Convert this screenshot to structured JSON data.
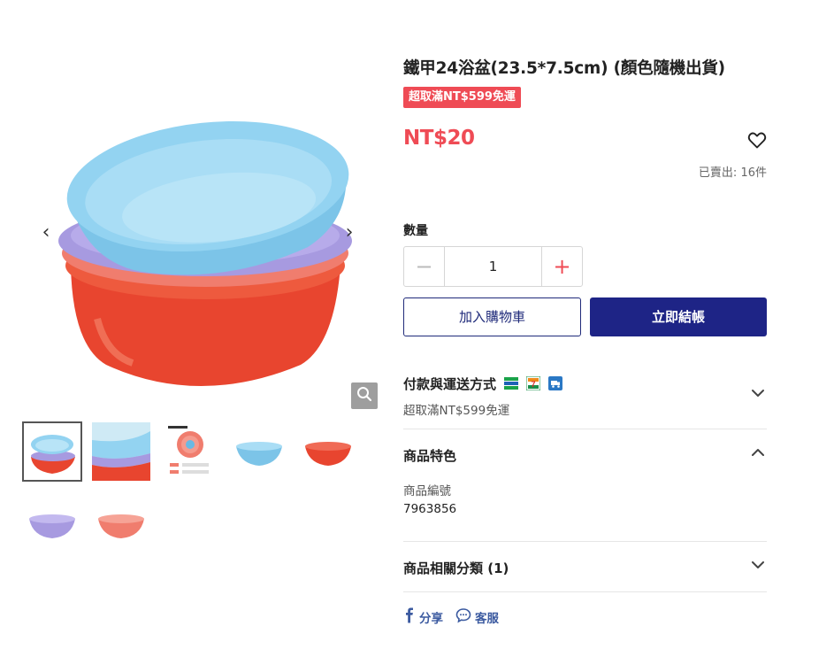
{
  "product": {
    "title": "鐵甲24浴盆(23.5*7.5cm) (顏色隨機出貨)",
    "promo_badge": "超取滿NT$599免運",
    "price": "NT$20",
    "sold_label": "已賣出:",
    "sold_count": "16件"
  },
  "quantity": {
    "label": "數量",
    "value": "1",
    "minus": "−",
    "plus": "+"
  },
  "actions": {
    "add_to_cart": "加入購物車",
    "buy_now": "立即結帳"
  },
  "sections": {
    "payment": {
      "title": "付款與運送方式",
      "subtitle": "超取滿NT$599免運",
      "icons": [
        "familymart-icon",
        "seven-eleven-icon",
        "delivery-truck-icon"
      ]
    },
    "features": {
      "title": "商品特色",
      "sku_label": "商品編號",
      "sku_value": "7963856"
    },
    "categories": {
      "title": "商品相關分類 (1)"
    }
  },
  "social": {
    "share": "分享",
    "support": "客服"
  },
  "thumbnails": [
    {
      "name": "thumb-stacked-basins",
      "active": true
    },
    {
      "name": "thumb-closeup",
      "active": false
    },
    {
      "name": "thumb-size-chart",
      "active": false
    },
    {
      "name": "thumb-blue-basin",
      "active": false
    },
    {
      "name": "thumb-red-basin",
      "active": false
    },
    {
      "name": "thumb-purple-basin",
      "active": false
    },
    {
      "name": "thumb-pink-basin",
      "active": false
    }
  ],
  "colors": {
    "accent_red": "#ef4b55",
    "primary_navy": "#1e2486",
    "basin_blue": "#8fd0ee",
    "basin_purple": "#a79ae0",
    "basin_pink": "#f07d6e",
    "basin_red": "#e8452f"
  }
}
